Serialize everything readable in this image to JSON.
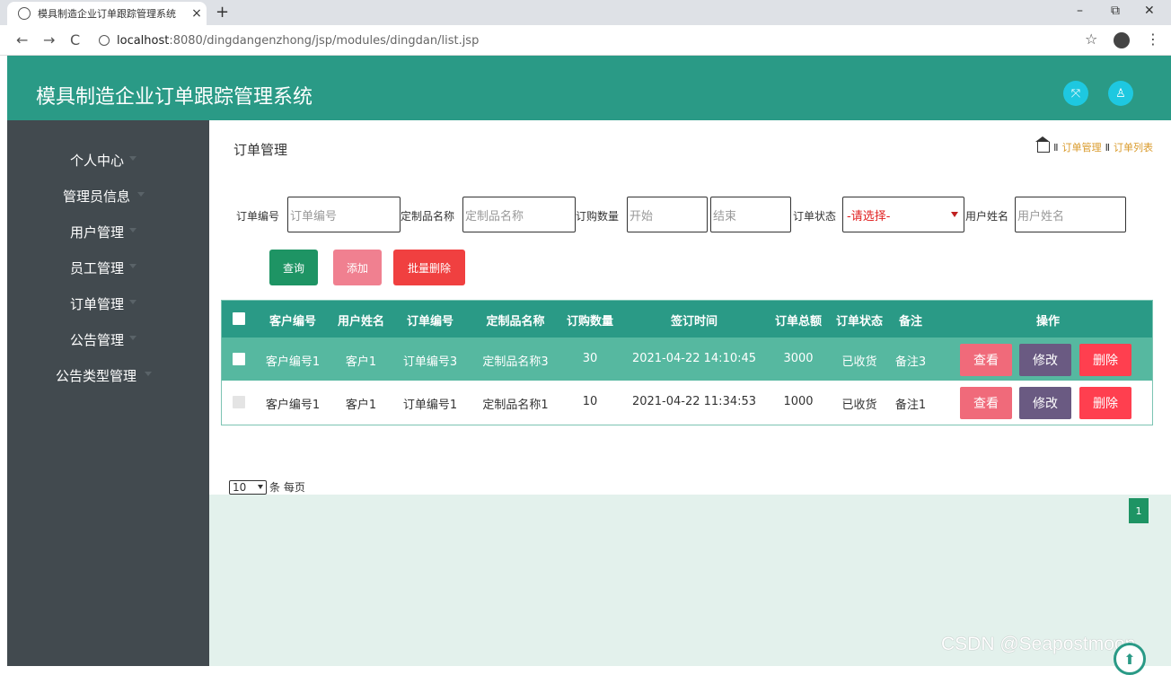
{
  "browser": {
    "tab_title": "模具制造企业订单跟踪管理系统",
    "tab_close": "×",
    "new_tab": "+",
    "url_host": "localhost",
    "url_path": ":8080/dingdangenzhong/jsp/modules/dingdan/list.jsp",
    "back": "←",
    "forward": "→",
    "reload": "C",
    "star": "☆",
    "kebab": "⋮",
    "minimize": "–",
    "restore": "⧉",
    "close": "✕"
  },
  "header": {
    "title": "模具制造企业订单跟踪管理系统"
  },
  "sidebar": {
    "items": [
      {
        "label": "个人中心"
      },
      {
        "label": "管理员信息"
      },
      {
        "label": "用户管理"
      },
      {
        "label": "员工管理"
      },
      {
        "label": "订单管理"
      },
      {
        "label": "公告管理"
      },
      {
        "label": "公告类型管理"
      }
    ]
  },
  "content": {
    "title": "订单管理",
    "breadcrumb": {
      "sep": "Ⅱ",
      "level1": "订单管理",
      "level2": "订单列表"
    }
  },
  "filters": {
    "order_no_label": "订单编号",
    "order_no_placeholder": "订单编号",
    "product_label": "定制品名称",
    "product_placeholder": "定制品名称",
    "qty_label": "订购数量",
    "qty_start_placeholder": "开始",
    "qty_end_placeholder": "结束",
    "status_label": "订单状态",
    "status_selected": "-请选择-",
    "user_label": "用户姓名",
    "user_placeholder": "用户姓名"
  },
  "actions": {
    "search": "查询",
    "add": "添加",
    "batch_delete": "批量删除"
  },
  "table": {
    "headers": [
      "客户编号",
      "用户姓名",
      "订单编号",
      "定制品名称",
      "订购数量",
      "签订时间",
      "订单总额",
      "订单状态",
      "备注",
      "操作"
    ],
    "rows": [
      {
        "customer_no": "客户编号1",
        "user_name": "客户1",
        "order_no": "订单编号3",
        "product": "定制品名称3",
        "qty": "30",
        "signed_at": "2021-04-22 14:10:45",
        "total": "3000",
        "status": "已收货",
        "note": "备注3"
      },
      {
        "customer_no": "客户编号1",
        "user_name": "客户1",
        "order_no": "订单编号1",
        "product": "定制品名称1",
        "qty": "10",
        "signed_at": "2021-04-22 11:34:53",
        "total": "1000",
        "status": "已收货",
        "note": "备注1"
      }
    ],
    "row_actions": {
      "view": "查看",
      "edit": "修改",
      "delete": "删除"
    }
  },
  "pager": {
    "page_size": "10",
    "per_page_text": "条 每页",
    "current_page": "1"
  },
  "watermark": "CSDN @Seapostmoon",
  "colors": {
    "header": "#2a9a86",
    "sidebar": "#424a4f",
    "search_btn": "#1e9464",
    "add_btn": "#f08090",
    "batch_delete_btn": "#f04040",
    "view_btn": "#f06a7a",
    "edit_btn": "#6a5a82",
    "delete_btn": "#ff3f4f"
  }
}
